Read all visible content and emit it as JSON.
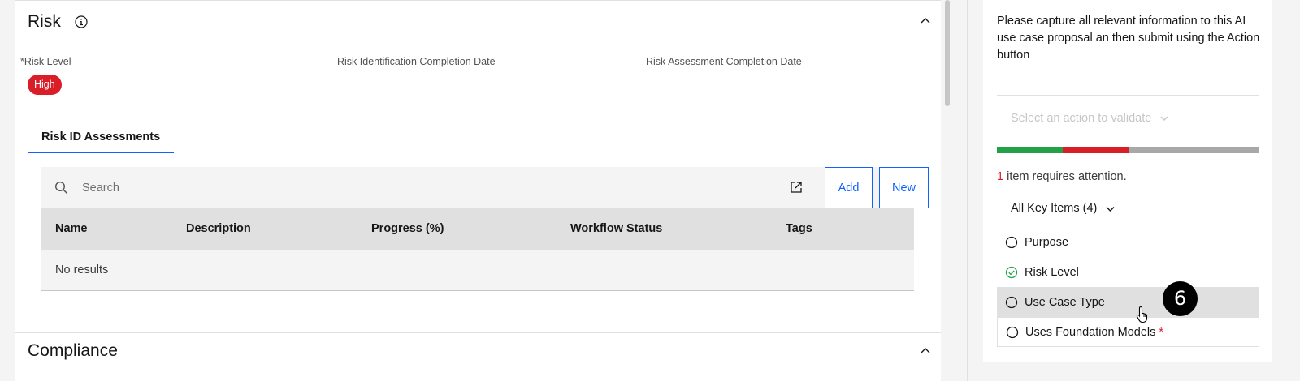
{
  "risk": {
    "title": "Risk",
    "fields": {
      "risk_level_label": "Risk Level",
      "required_marker": "*",
      "risk_level_value": "High",
      "identification_label": "Risk Identification Completion Date",
      "assessment_label": "Risk Assessment Completion Date"
    },
    "tab_label": "Risk ID Assessments",
    "search_placeholder": "Search",
    "add_label": "Add",
    "new_label": "New",
    "columns": [
      "Name",
      "Description",
      "Progress (%)",
      "Workflow Status",
      "Tags"
    ],
    "empty_message": "No results"
  },
  "compliance": {
    "title": "Compliance"
  },
  "side_panel": {
    "instructions": "Please capture all relevant information to this AI use case proposal an then submit using the Action button",
    "action_placeholder": "Select an action to validate",
    "progress": {
      "complete": 0.25,
      "attention": 0.25,
      "colors": {
        "complete": "#24a148",
        "attention": "#da1e28",
        "remaining": "#a8a8a8"
      }
    },
    "attention_count": "1",
    "attention_text": " item requires attention.",
    "key_items_label": "All Key Items (4)",
    "items": [
      {
        "label": "Purpose",
        "status": "empty"
      },
      {
        "label": "Risk Level",
        "status": "complete"
      },
      {
        "label": "Use Case Type",
        "status": "empty"
      },
      {
        "label": "Uses Foundation Models",
        "status": "empty",
        "required": "*"
      }
    ]
  },
  "annotation": {
    "step": "6"
  }
}
